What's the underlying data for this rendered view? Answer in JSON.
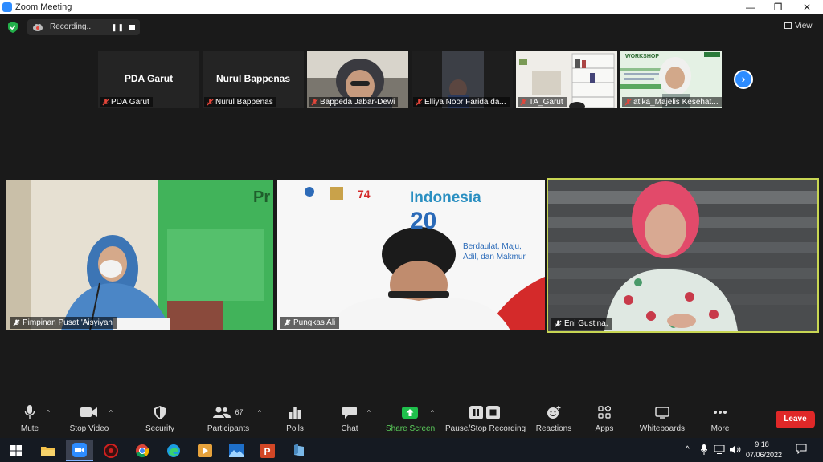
{
  "window": {
    "title": "Zoom Meeting",
    "controls": [
      "—",
      "❐",
      "✕"
    ]
  },
  "topbar": {
    "recording_label": "Recording...",
    "pause_glyph": "❚❚",
    "view_label": "View"
  },
  "thumbnails": [
    {
      "name": "PDA Garut",
      "big_name": "PDA Garut",
      "muted": true
    },
    {
      "name": "Nurul Bappenas",
      "big_name": "Nurul Bappenas",
      "muted": true
    },
    {
      "name": "Bappeda Jabar-Dewi",
      "muted": true
    },
    {
      "name": "Elliya Noor Farida da...",
      "muted": true
    },
    {
      "name": "TA_Garut",
      "muted": true
    },
    {
      "name": "atika_Majelis Kesehat...",
      "muted": true,
      "slide_title": "WORKSHOP"
    }
  ],
  "tiles": [
    {
      "name": "Pimpinan Pusat 'Aisyiyah",
      "backdrop_text": "Pr"
    },
    {
      "name": "Pungkas Ali",
      "backdrop_title": "Indonesia",
      "backdrop_number": "20",
      "backdrop_slogan": [
        "Berdaulat, Maju,",
        "Adil, dan Makmur"
      ]
    },
    {
      "name": "Eni Gustina,",
      "active_speaker": true
    }
  ],
  "toolbar": {
    "mute": "Mute",
    "stop_video": "Stop Video",
    "security": "Security",
    "participants": "Participants",
    "participants_count": "67",
    "polls": "Polls",
    "chat": "Chat",
    "share_screen": "Share Screen",
    "recording": "Pause/Stop Recording",
    "reactions": "Reactions",
    "apps": "Apps",
    "whiteboards": "Whiteboards",
    "more": "More",
    "leave": "Leave"
  },
  "taskbar": {
    "time": "9:18",
    "date": "07/06/2022",
    "tray_chevron": "^"
  },
  "colors": {
    "accent": "#2d8cff",
    "leave": "#e02828",
    "share": "#1fbf4c",
    "active_border": "#c8d653",
    "muted_mic": "#e5463b"
  }
}
